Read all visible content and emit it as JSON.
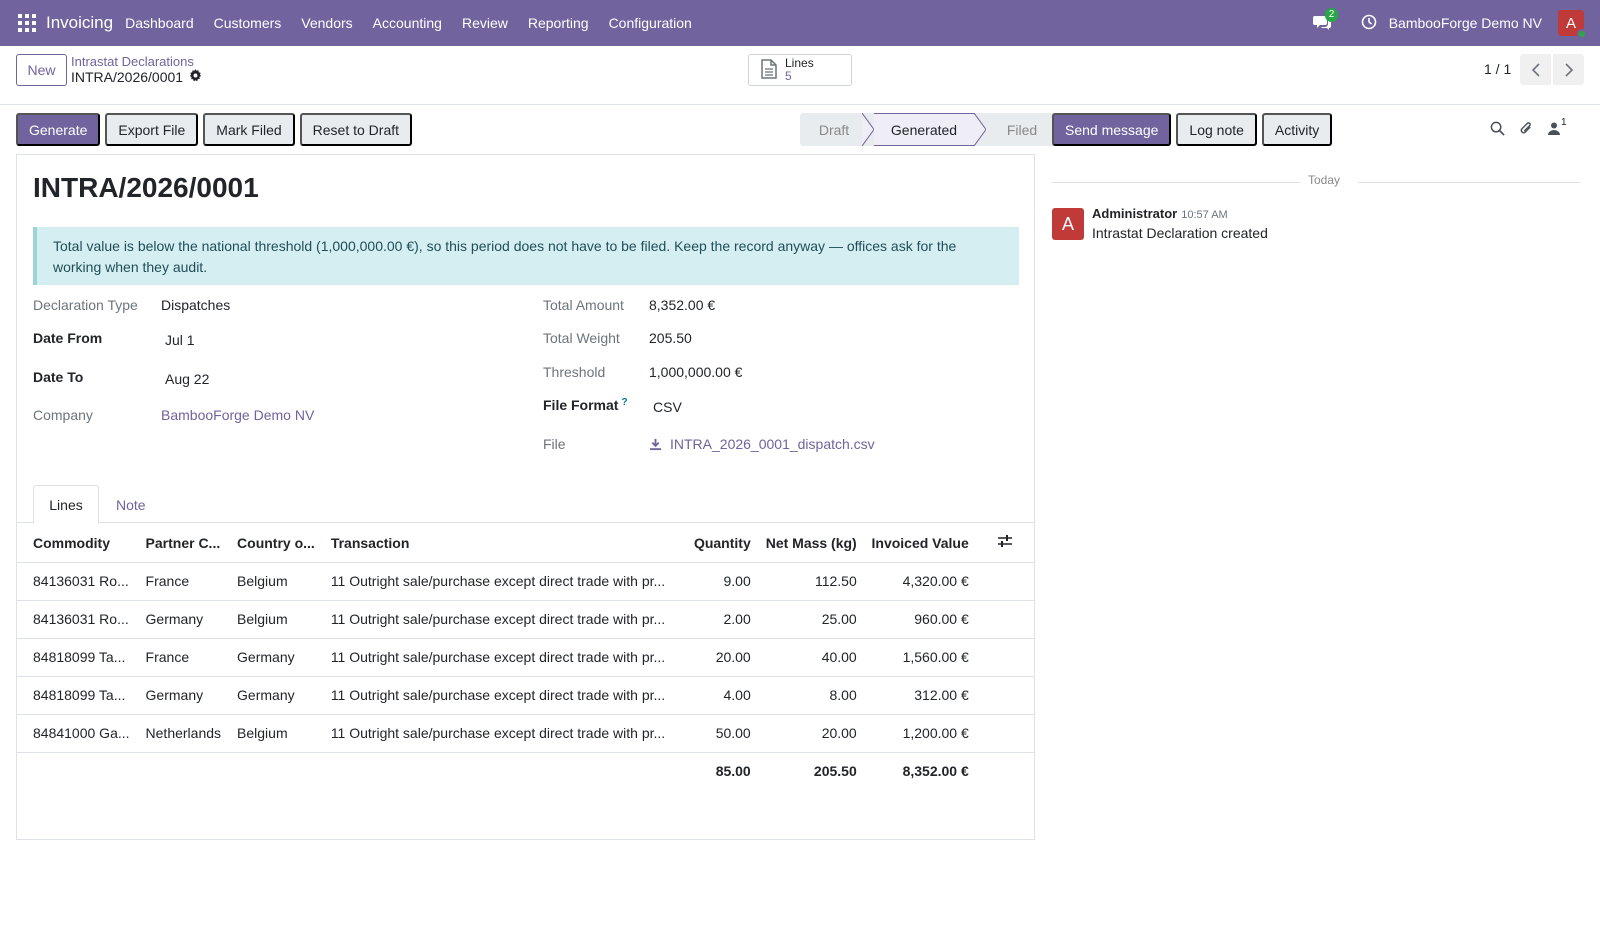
{
  "navbar": {
    "app_name": "Invoicing",
    "menu": [
      "Dashboard",
      "Customers",
      "Vendors",
      "Accounting",
      "Review",
      "Reporting",
      "Configuration"
    ],
    "chat_badge": "2",
    "company": "BambooForge Demo NV",
    "avatar_letter": "A"
  },
  "control": {
    "new_label": "New",
    "breadcrumb_parent": "Intrastat Declarations",
    "breadcrumb_current": "INTRA/2026/0001",
    "smart_button": {
      "label": "Lines",
      "value": "5"
    },
    "pager": "1 / 1"
  },
  "actions": {
    "generate": "Generate",
    "export": "Export File",
    "mark_filed": "Mark Filed",
    "reset": "Reset to Draft"
  },
  "status": {
    "stages": [
      "Draft",
      "Generated",
      "Filed"
    ],
    "current": "Generated"
  },
  "chatter": {
    "send_message": "Send message",
    "log_note": "Log note",
    "activity": "Activity",
    "follower_count": "1",
    "today": "Today",
    "message": {
      "avatar_letter": "A",
      "author": "Administrator",
      "time": "10:57 AM",
      "body": "Intrastat Declaration created"
    }
  },
  "form": {
    "title": "INTRA/2026/0001",
    "alert": "Total value is below the national threshold (1,000,000.00 €), so this period does not have to be filed. Keep the record anyway — offices ask for the working when they audit.",
    "left_fields": {
      "declaration_type": {
        "label": "Declaration Type",
        "value": "Dispatches"
      },
      "date_from": {
        "label": "Date From",
        "value": "Jul 1"
      },
      "date_to": {
        "label": "Date To",
        "value": "Aug 22"
      },
      "company": {
        "label": "Company",
        "value": "BambooForge Demo NV"
      }
    },
    "right_fields": {
      "total_amount": {
        "label": "Total Amount",
        "value": "8,352.00 €"
      },
      "total_weight": {
        "label": "Total Weight",
        "value": "205.50"
      },
      "threshold": {
        "label": "Threshold",
        "value": "1,000,000.00 €"
      },
      "file_format": {
        "label": "File Format",
        "help": "?",
        "value": "CSV"
      },
      "file": {
        "label": "File",
        "value": "INTRA_2026_0001_dispatch.csv"
      }
    },
    "tabs": [
      "Lines",
      "Note"
    ],
    "table": {
      "headers": [
        "Commodity",
        "Partner C...",
        "Country o...",
        "Transaction",
        "Quantity",
        "Net Mass (kg)",
        "Invoiced Value"
      ],
      "rows": [
        [
          "84136031 Ro...",
          "France",
          "Belgium",
          "11 Outright sale/purchase except direct trade with pr...",
          "9.00",
          "112.50",
          "4,320.00 €"
        ],
        [
          "84136031 Ro...",
          "Germany",
          "Belgium",
          "11 Outright sale/purchase except direct trade with pr...",
          "2.00",
          "25.00",
          "960.00 €"
        ],
        [
          "84818099 Ta...",
          "France",
          "Germany",
          "11 Outright sale/purchase except direct trade with pr...",
          "20.00",
          "40.00",
          "1,560.00 €"
        ],
        [
          "84818099 Ta...",
          "Germany",
          "Germany",
          "11 Outright sale/purchase except direct trade with pr...",
          "4.00",
          "8.00",
          "312.00 €"
        ],
        [
          "84841000 Ga...",
          "Netherlands",
          "Belgium",
          "11 Outright sale/purchase except direct trade with pr...",
          "50.00",
          "20.00",
          "1,200.00 €"
        ]
      ],
      "totals": {
        "quantity": "85.00",
        "net_mass": "205.50",
        "invoiced_value": "8,352.00 €"
      }
    }
  }
}
